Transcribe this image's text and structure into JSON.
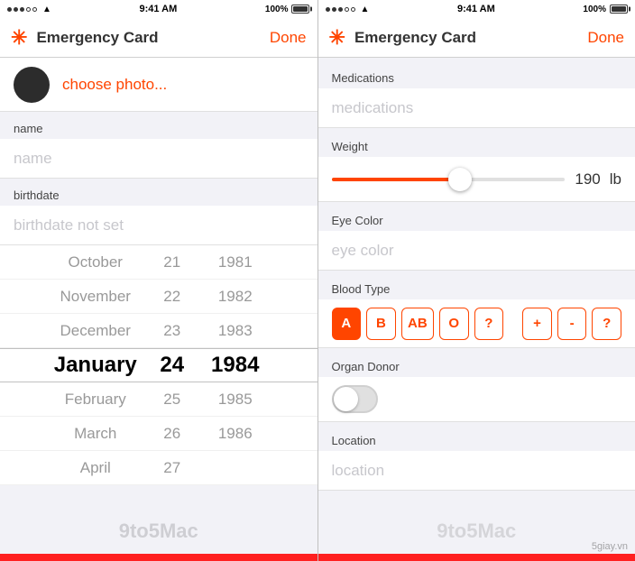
{
  "left_panel": {
    "status_bar": {
      "time": "9:41 AM",
      "battery": "100%"
    },
    "nav": {
      "asterisk": "✳",
      "title": "Emergency Card",
      "done": "Done"
    },
    "photo": {
      "choose_label": "choose photo..."
    },
    "name_field": {
      "label": "name",
      "placeholder": "name"
    },
    "birthdate_field": {
      "label": "birthdate",
      "placeholder": "birthdate not set"
    },
    "picker": {
      "rows": [
        {
          "month": "October",
          "day": "21",
          "year": "1981",
          "style": "faded"
        },
        {
          "month": "November",
          "day": "22",
          "year": "1982",
          "style": "faded"
        },
        {
          "month": "December",
          "day": "23",
          "year": "1983",
          "style": "faded"
        },
        {
          "month": "January",
          "day": "24",
          "year": "1984",
          "style": "selected"
        },
        {
          "month": "February",
          "day": "25",
          "year": "1985",
          "style": "faded"
        },
        {
          "month": "March",
          "day": "26",
          "year": "1986",
          "style": "faded"
        },
        {
          "month": "April",
          "day": "27",
          "year": "",
          "style": "faded"
        }
      ]
    }
  },
  "right_panel": {
    "status_bar": {
      "time": "9:41 AM",
      "battery": "100%"
    },
    "nav": {
      "asterisk": "✳",
      "title": "Emergency Card",
      "done": "Done"
    },
    "medications": {
      "label": "Medications",
      "placeholder": "medications"
    },
    "weight": {
      "label": "Weight",
      "value": "190",
      "unit": "lb",
      "slider_pct": 55
    },
    "eye_color": {
      "label": "Eye Color",
      "placeholder": "eye color"
    },
    "blood_type": {
      "label": "Blood Type",
      "buttons": [
        {
          "label": "A",
          "active": true
        },
        {
          "label": "B",
          "active": false
        },
        {
          "label": "AB",
          "active": false,
          "wide": true
        },
        {
          "label": "O",
          "active": false
        },
        {
          "label": "?",
          "active": false
        }
      ],
      "rh_buttons": [
        {
          "label": "+",
          "active": false
        },
        {
          "label": "-",
          "active": false
        },
        {
          "label": "?",
          "active": false
        }
      ]
    },
    "organ_donor": {
      "label": "Organ Donor",
      "on": false
    },
    "location": {
      "label": "Location",
      "placeholder": "location"
    }
  },
  "watermarks": {
    "left": "9to5Mac",
    "right": "5giay.vn"
  }
}
